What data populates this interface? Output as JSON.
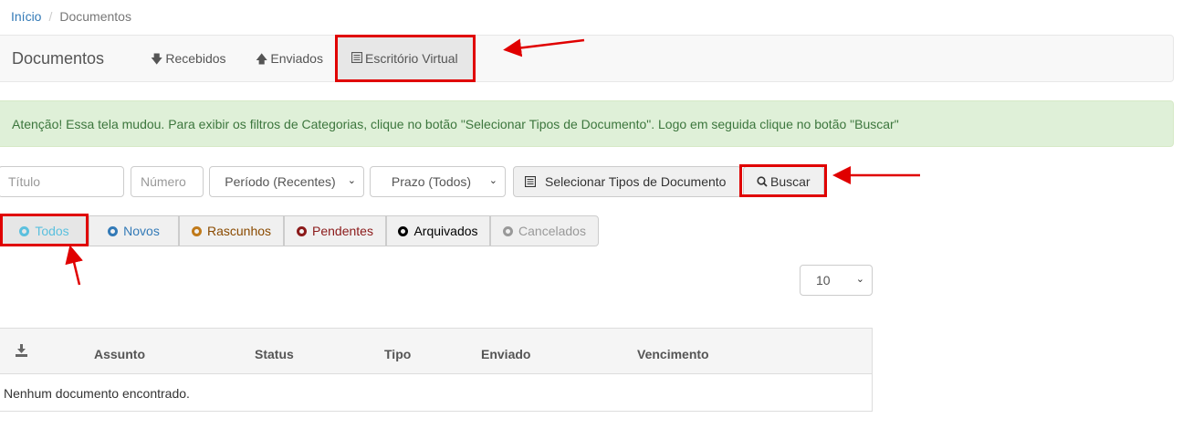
{
  "breadcrumb": {
    "home": "Início",
    "separator": "/",
    "current": "Documentos"
  },
  "navbar": {
    "brand": "Documentos",
    "items": [
      {
        "label": "Recebidos",
        "icon": "arrow-down-icon"
      },
      {
        "label": "Enviados",
        "icon": "arrow-up-icon"
      },
      {
        "label": "Escritório Virtual",
        "icon": "list-alt-icon",
        "active": true
      }
    ]
  },
  "alert": {
    "text": "Atenção! Essa tela mudou. Para exibir os filtros de Categorias, clique no botão \"Selecionar Tipos de Documento\". Logo em seguida clique no botão \"Buscar\""
  },
  "filters": {
    "title_placeholder": "Título",
    "number_placeholder": "Número",
    "period": "Período (Recentes)",
    "deadline": "Prazo (Todos)",
    "select_types_label": "Selecionar Tipos de Documento",
    "search_label": "Buscar"
  },
  "status_tabs": [
    {
      "label": "Todos",
      "color": "#5bc0de"
    },
    {
      "label": "Novos",
      "color": "#337ab7"
    },
    {
      "label": "Rascunhos",
      "color": "#c07a1a"
    },
    {
      "label": "Pendentes",
      "color": "#8b1a1a"
    },
    {
      "label": "Arquivados",
      "color": "#000000"
    },
    {
      "label": "Cancelados",
      "color": "#999999"
    }
  ],
  "page_size": "10",
  "table": {
    "columns": [
      "Assunto",
      "Status",
      "Tipo",
      "Enviado",
      "Vencimento"
    ],
    "empty_message": "Nenhum documento encontrado."
  },
  "colors": {
    "annotation": "#e00000",
    "link": "#337ab7",
    "alert_bg": "#dff0d8"
  }
}
